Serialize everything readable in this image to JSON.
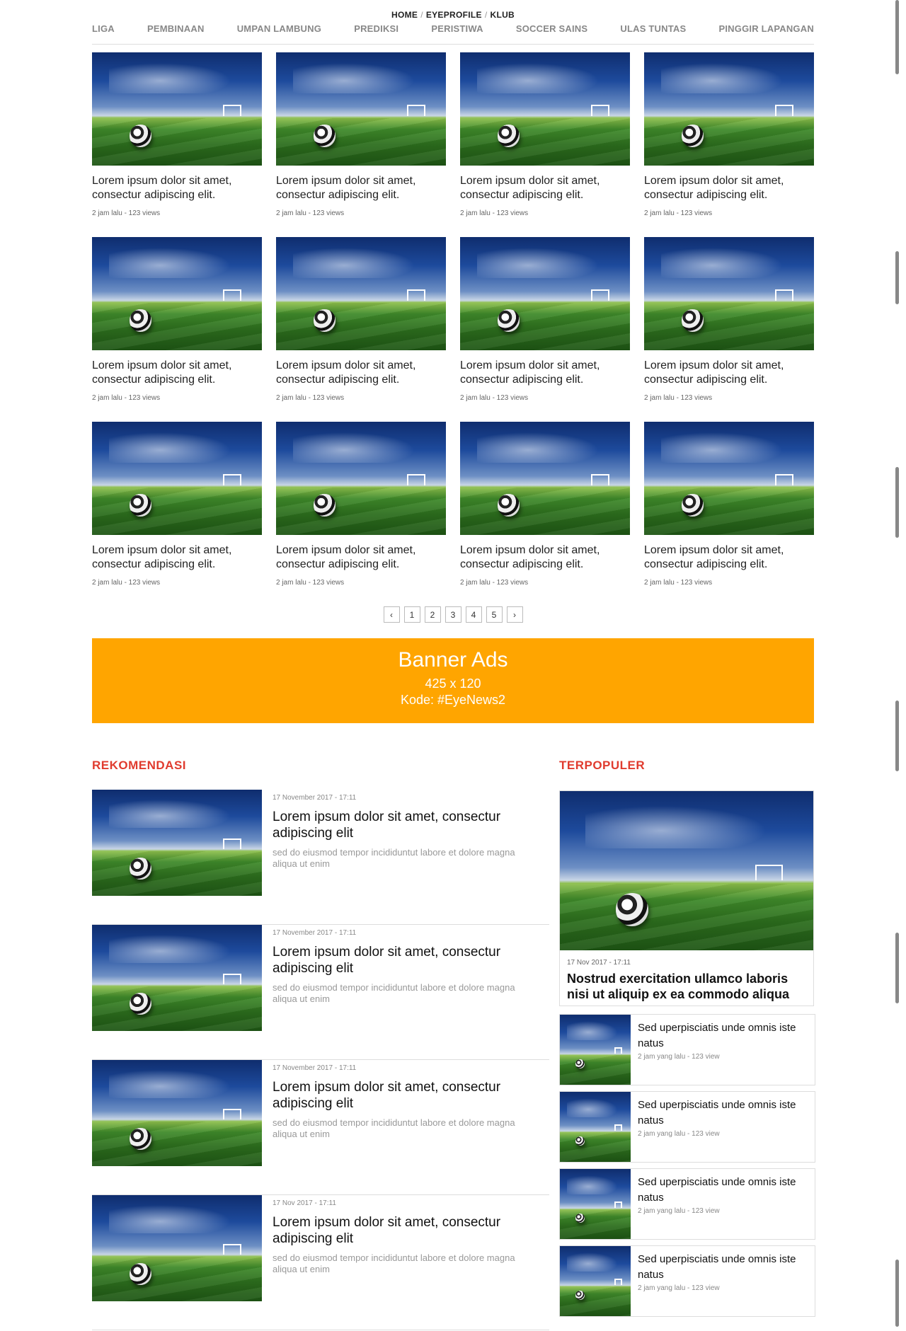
{
  "breadcrumb": {
    "home": "HOME",
    "profile": "EYEPROFILE",
    "club": "KLUB",
    "separator": "/"
  },
  "categories": [
    "LIGA",
    "PEMBINAAN",
    "UMPAN LAMBUNG",
    "PREDIKSI",
    "PERISTIWA",
    "SOCCER SAINS",
    "ULAS TUNTAS",
    "PINGGIR LAPANGAN"
  ],
  "grid": {
    "title": "Lorem ipsum dolor sit amet, consectur adipiscing elit.",
    "meta": "2 jam lalu - 123 views",
    "count": 12
  },
  "pagination": {
    "prev": "‹",
    "pages": [
      "1",
      "2",
      "3",
      "4",
      "5"
    ],
    "next": "›"
  },
  "banner": {
    "title": "Banner Ads",
    "size": "425 x 120",
    "code": "Kode: #EyeNews2",
    "color": "#ffa500"
  },
  "rekomendasi": {
    "heading": "REKOMENDASI",
    "items": [
      {
        "date": "17 November 2017  -  17:11",
        "title": "Lorem ipsum dolor sit amet, consectur adipiscing elit",
        "desc": "sed do eiusmod tempor incididuntut labore et dolore magna aliqua ut enim"
      },
      {
        "date": "17 November 2017  -  17:11",
        "title": "Lorem ipsum dolor sit amet, consectur adipiscing elit",
        "desc": "sed do eiusmod tempor incididuntut labore et dolore magna aliqua ut enim"
      },
      {
        "date": "17 November 2017  -  17:11",
        "title": "Lorem ipsum dolor sit amet, consectur adipiscing elit",
        "desc": "sed do eiusmod tempor incididuntut labore et dolore magna aliqua ut enim"
      },
      {
        "date": "17 Nov 2017  -  17:11",
        "title": "Lorem ipsum dolor sit amet, consectur adipiscing elit",
        "desc": "sed do eiusmod tempor incididuntut labore et dolore magna aliqua ut enim"
      }
    ]
  },
  "terpopuler": {
    "heading": "TERPOPULER",
    "main": {
      "date": "17 Nov 2017  -  17:11",
      "title": "Nostrud exercitation ullamco laboris nisi ut aliquip ex ea commodo aliqua"
    },
    "items": [
      {
        "title": "Sed uperpisciatis unde omnis iste natus",
        "meta": "2 jam yang lalu  -  123 view"
      },
      {
        "title": "Sed uperpisciatis unde omnis iste natus",
        "meta": "2 jam yang lalu  -  123 view"
      },
      {
        "title": "Sed uperpisciatis unde omnis iste natus",
        "meta": "2 jam yang lalu  -  123 view"
      },
      {
        "title": "Sed uperpisciatis unde omnis iste natus",
        "meta": "2 jam yang lalu  -  123 view"
      }
    ]
  },
  "colors": {
    "accent": "#e03b2e",
    "banner": "#ffa500"
  }
}
